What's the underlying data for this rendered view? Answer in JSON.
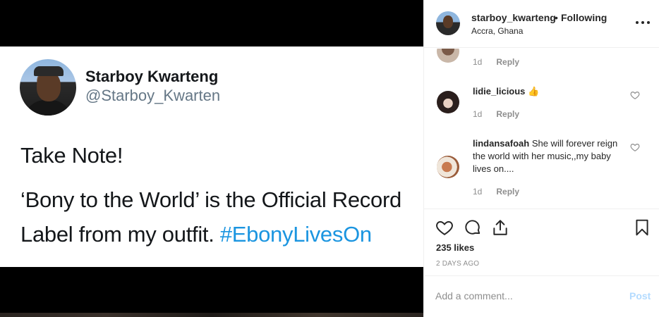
{
  "tweet": {
    "display_name": "Starboy Kwarteng",
    "handle": "@Starboy_Kwarten",
    "line1": "Take Note!",
    "line2": "‘Bony to the World’ is the Official Record",
    "line3_text": "Label from my outfit. ",
    "hashtag": "#EbonyLivesOn"
  },
  "post_header": {
    "username": "starboy_kwarteng",
    "separator": "•",
    "follow_status": "Following",
    "location": "Accra, Ghana",
    "more_icon": "more-options-icon"
  },
  "comments": [
    {
      "username": "",
      "text": "",
      "age": "1d",
      "reply_label": "Reply"
    },
    {
      "username": "lidie_licious",
      "text": "👍",
      "age": "1d",
      "reply_label": "Reply"
    },
    {
      "username": "lindansafoah",
      "text": "She will forever reign the world with her music,,my baby lives on....",
      "age": "1d",
      "reply_label": "Reply"
    }
  ],
  "actions": {
    "like_icon": "heart-icon",
    "comment_icon": "comment-icon",
    "share_icon": "share-icon",
    "save_icon": "bookmark-icon",
    "likes": "235 likes",
    "posted": "2 DAYS AGO"
  },
  "add_comment": {
    "placeholder": "Add a comment...",
    "post_label": "Post"
  },
  "colors": {
    "hashtag": "#1b95e0",
    "post_button_disabled": "#b3dbff",
    "secondary_text": "#8e8e8e"
  }
}
